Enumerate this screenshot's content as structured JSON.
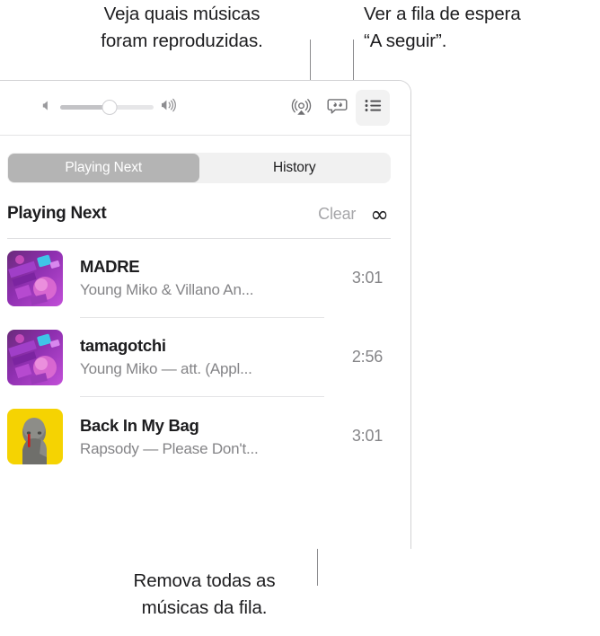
{
  "callouts": {
    "history": "Veja quais músicas\nforam reproduzidas.",
    "queue": "Ver a fila de espera\n“A seguir”.",
    "clear": "Remova todas as\nmúsicas da fila."
  },
  "toolbar": {
    "volume": {
      "min_icon": "speaker-low-icon",
      "max_icon": "speaker-high-icon",
      "value_percent": 53
    },
    "buttons": [
      {
        "name": "airplay-button",
        "icon": "airplay-icon",
        "active": false
      },
      {
        "name": "lyrics-button",
        "icon": "lyrics-quote-bubble-icon",
        "active": false
      },
      {
        "name": "queue-button",
        "icon": "queue-list-icon",
        "active": true
      }
    ]
  },
  "tabs": [
    {
      "label": "Playing Next",
      "selected": true
    },
    {
      "label": "History",
      "selected": false
    }
  ],
  "section": {
    "title": "Playing Next",
    "clear_label": "Clear",
    "infinity_label": "∞"
  },
  "tracks": [
    {
      "title": "MADRE",
      "subtitle": "Young Miko & Villano An...",
      "duration": "3:01",
      "artwork": "purple-neon-album-art"
    },
    {
      "title": "tamagotchi",
      "subtitle": "Young Miko — att. (Appl...",
      "duration": "2:56",
      "artwork": "purple-neon-album-art"
    },
    {
      "title": "Back In My Bag",
      "subtitle": "Rapsody — Please Don't...",
      "duration": "3:01",
      "artwork": "yellow-portrait-album-art"
    }
  ],
  "colors": {
    "accent_selected_tab": "#b4b4b4",
    "leader_line": "#8b8b8e",
    "text_primary": "#1d1d1f",
    "text_secondary": "#848487"
  }
}
